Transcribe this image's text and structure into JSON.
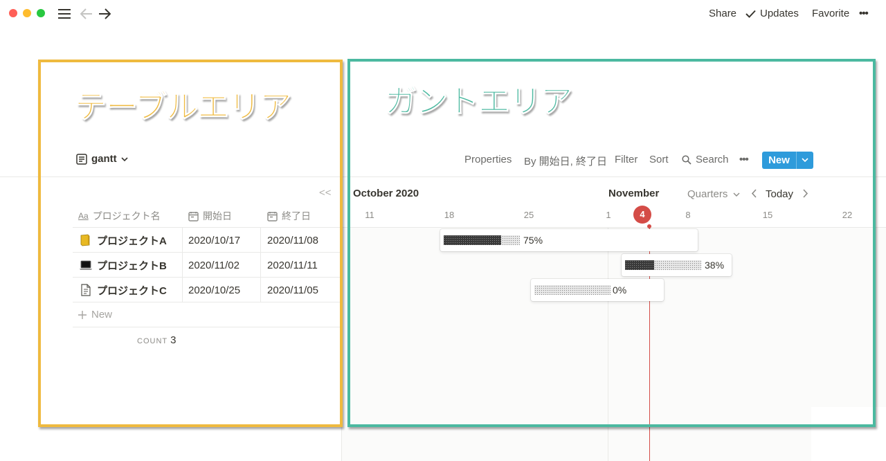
{
  "topbar": {
    "share": "Share",
    "updates": "Updates",
    "favorite": "Favorite",
    "more": "•••"
  },
  "annotations": {
    "table_area": "テーブルエリア",
    "gantt_area": "ガントエリア",
    "table_color": "#efba3f",
    "gantt_color": "#4bb9a0"
  },
  "view": {
    "name": "gantt"
  },
  "toolbar": {
    "properties": "Properties",
    "by": "By 開始日, 終了日",
    "filter": "Filter",
    "sort": "Sort",
    "search": "Search",
    "more": "•••",
    "new": "New",
    "accent": "#2e9bdb"
  },
  "table": {
    "collapse": "<<",
    "columns": [
      {
        "label": "プロジェクト名",
        "icon": "Aa"
      },
      {
        "label": "開始日",
        "icon": "calendar-icon"
      },
      {
        "label": "終了日",
        "icon": "calendar-icon"
      }
    ],
    "rows": [
      {
        "name": "プロジェクトA",
        "icon": "folder-icon",
        "start": "2020/10/17",
        "end": "2020/11/08"
      },
      {
        "name": "プロジェクトB",
        "icon": "laptop-icon",
        "start": "2020/11/02",
        "end": "2020/11/11"
      },
      {
        "name": "プロジェクトC",
        "icon": "page-icon",
        "start": "2020/10/25",
        "end": "2020/11/05"
      }
    ],
    "new_row": "New",
    "count_label": "COUNT",
    "count_value": "3"
  },
  "gantt": {
    "month1": "October 2020",
    "month2": "November",
    "scale": "Quarters",
    "today": "Today",
    "today_day": "4",
    "days": [
      "11",
      "18",
      "25",
      "1",
      "8",
      "15",
      "22"
    ],
    "bars": [
      {
        "label": "75%",
        "progress": 0.75
      },
      {
        "label": "38%",
        "progress": 0.38
      },
      {
        "label": "0%",
        "progress": 0.0
      }
    ],
    "today_color": "#d44c47"
  }
}
